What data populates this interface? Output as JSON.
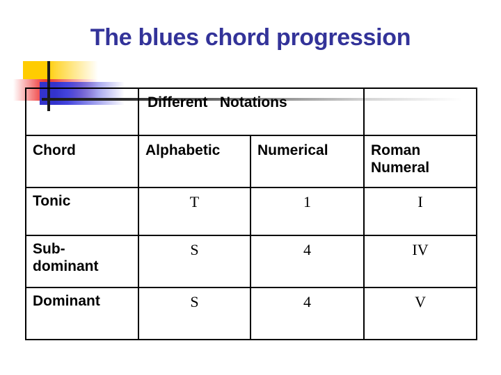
{
  "slide": {
    "title": "The blues chord progression",
    "title_color": "#333399",
    "background_color": "#ffffff"
  },
  "decoration": {
    "yellow_square": "#ffcc00",
    "red_square": "#e8352f",
    "blue_square": "#3333cc",
    "line_color": "#1a1a1a",
    "vertical_line_name": "deco-line-vertical",
    "horizontal_line_name": "deco-line-horizontal"
  },
  "table": {
    "banner": {
      "label": "Different   Notations",
      "spans_columns": [
        1,
        2
      ],
      "empty_left_cell": "",
      "empty_right_cell": ""
    },
    "columns": [
      "Chord",
      "Alphabetic",
      "Numerical",
      "Roman Numeral"
    ],
    "column_roman_line1": "Roman",
    "column_roman_line2": "Numeral",
    "rows": [
      {
        "chord": "Tonic",
        "chord_line1": "Tonic",
        "chord_line2": "",
        "alphabetic": "T",
        "numerical": "1",
        "roman": "I"
      },
      {
        "chord": "Sub-dominant",
        "chord_line1": "Sub-",
        "chord_line2": "dominant",
        "alphabetic": "S",
        "numerical": "4",
        "roman": "IV"
      },
      {
        "chord": "Dominant",
        "chord_line1": "Dominant",
        "chord_line2": "",
        "alphabetic": "S",
        "numerical": "4",
        "roman": "V"
      }
    ]
  }
}
